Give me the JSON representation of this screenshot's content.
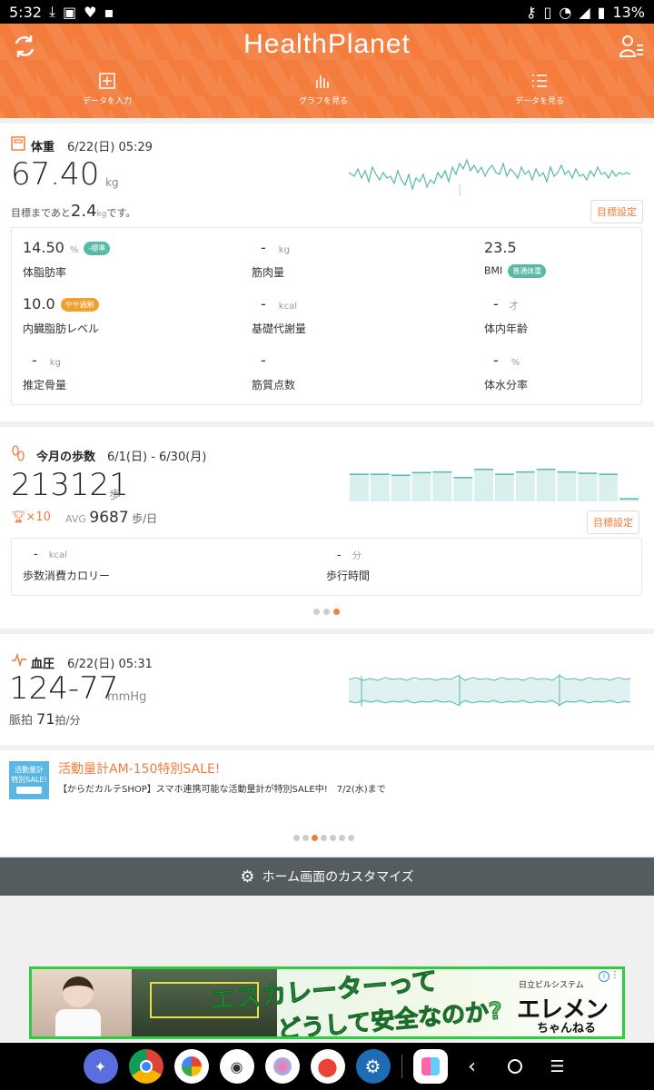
{
  "status": {
    "time": "5:32",
    "battery": "13%"
  },
  "header": {
    "logo": "HealthPlanet",
    "nav": [
      {
        "label": "データを入力"
      },
      {
        "label": "グラフを見る"
      },
      {
        "label": "データを見る"
      }
    ]
  },
  "weight": {
    "title": "体重",
    "date": "6/22(日) 05:29",
    "value": "67.40",
    "unit": "kg",
    "goal_prefix": "目標まであと",
    "goal_value": "2.4",
    "goal_unit": "kg",
    "goal_suffix": "です。",
    "goal_button": "目標設定",
    "metrics": [
      {
        "value": "14.50",
        "unit": "%",
        "badge": "-標準",
        "label": "体脂肪率"
      },
      {
        "value": "-",
        "unit": "kg",
        "badge": "",
        "label": "筋肉量"
      },
      {
        "value": "23.5",
        "unit": "",
        "badge": "",
        "label": "BMI",
        "label_badge": "普通体重"
      },
      {
        "value": "10.0",
        "unit": "",
        "badge": "やや過剰",
        "label": "内臓脂肪レベル"
      },
      {
        "value": "-",
        "unit": "kcal",
        "badge": "",
        "label": "基礎代謝量"
      },
      {
        "value": "-",
        "unit": "才",
        "badge": "",
        "label": "体内年齢"
      },
      {
        "value": "-",
        "unit": "kg",
        "badge": "",
        "label": "推定骨量"
      },
      {
        "value": "-",
        "unit": "",
        "badge": "",
        "label": "筋質点数"
      },
      {
        "value": "-",
        "unit": "%",
        "badge": "",
        "label": "体水分率"
      }
    ]
  },
  "steps": {
    "title": "今月の歩数",
    "date": "6/1(日) - 6/30(月)",
    "value": "213121",
    "unit": "歩",
    "trophy": "×10",
    "avg_label": "AVG",
    "avg_value": "9687",
    "avg_unit": "歩/日",
    "goal_button": "目標設定",
    "cal_value": "-",
    "cal_unit": "kcal",
    "cal_label": "歩数消費カロリー",
    "time_value": "-",
    "time_unit": "分",
    "time_label": "歩行時間",
    "bars": [
      0.85,
      0.85,
      0.82,
      0.9,
      0.92,
      0.75,
      1.0,
      0.85,
      0.92,
      1.0,
      0.92,
      0.88,
      0.85,
      0.1
    ]
  },
  "pressure": {
    "title": "血圧",
    "date": "6/22(日) 05:31",
    "value": "124-77",
    "unit": "mmHg",
    "pulse_label": "脈拍",
    "pulse_value": "71",
    "pulse_unit": "拍/分"
  },
  "promo": {
    "thumb_line1": "活動量計",
    "thumb_line2": "特別SALE!",
    "title": "活動量計AM-150特別SALE!",
    "desc": "【からだカルテSHOP】スマホ連携可能な活動量計が特別SALE中!　7/2(水)まで"
  },
  "customize_label": "ホーム画面のカスタマイズ",
  "ad": {
    "headline1": "エスカレーターって",
    "headline2": "どうして安全なのか?",
    "brand_small": "日立ビルシステム",
    "brand_big": "エレメン",
    "brand_sub": "ちゃんねる"
  },
  "colors": {
    "accent": "#f47c3c",
    "teal": "#59b9a8"
  }
}
